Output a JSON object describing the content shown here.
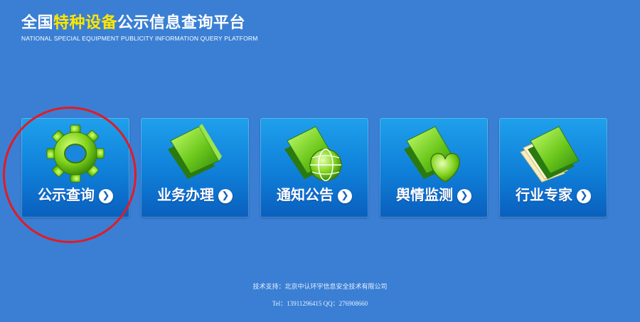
{
  "header": {
    "title_pre": "全国",
    "title_hl": "特种设备",
    "title_post": "公示信息查询平台",
    "subtitle": "NATIONAL SPECIAL EQUIPMENT PUBLICITY INFORMATION QUERY PLATFORM"
  },
  "tiles": [
    {
      "label": "公示查询",
      "icon": "gear-icon"
    },
    {
      "label": "业务办理",
      "icon": "folder-icon"
    },
    {
      "label": "通知公告",
      "icon": "folder-globe-icon"
    },
    {
      "label": "舆情监测",
      "icon": "folder-heart-icon"
    },
    {
      "label": "行业专家",
      "icon": "folder-papers-icon"
    }
  ],
  "arrow_glyph": "❯",
  "footer": {
    "support": "技术支持：北京中认环宇信息安全技术有限公司",
    "contact": "Tel：13911296415 QQ：276908660"
  },
  "colors": {
    "background": "#3a7fd4",
    "highlight": "#ffe600",
    "annotation_circle": "#e21b23"
  }
}
